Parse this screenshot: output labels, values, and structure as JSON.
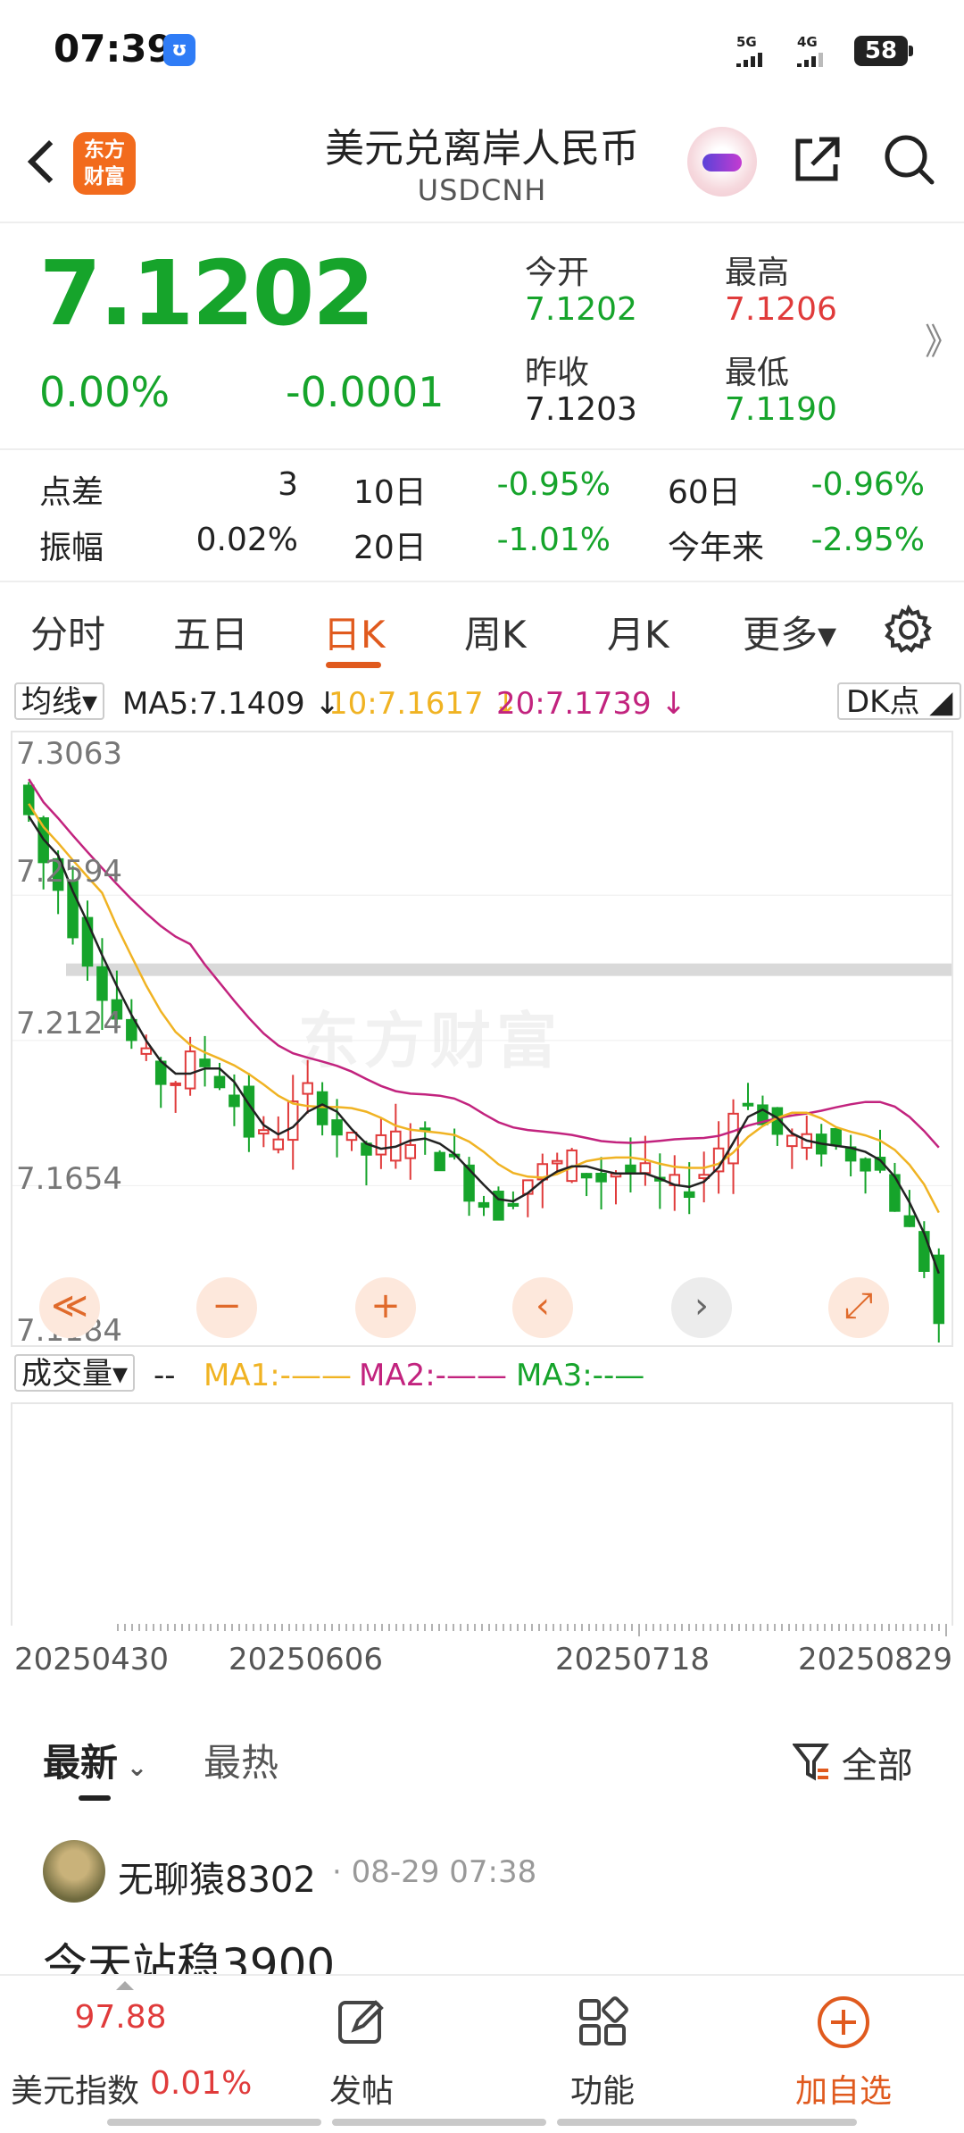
{
  "status_bar": {
    "time": "07:39",
    "app_badge": "ʊ",
    "signal_1": "5G",
    "signal_2": "4G",
    "battery": "58"
  },
  "header": {
    "logo_line1": "东方",
    "logo_line2": "财富",
    "title": "美元兑离岸人民币",
    "subtitle": "USDCNH"
  },
  "quote": {
    "price": "7.1202",
    "change_pct": "0.00%",
    "change": "-0.0001",
    "open_label": "今开",
    "open": "7.1202",
    "high_label": "最高",
    "high": "7.1206",
    "prev_close_label": "昨收",
    "prev_close": "7.1203",
    "low_label": "最低",
    "low": "7.1190",
    "more": "》"
  },
  "stats": {
    "spread_label": "点差",
    "spread": "3",
    "amplitude_label": "振幅",
    "amplitude": "0.02%",
    "d10_label": "10日",
    "d10": "-0.95%",
    "d20_label": "20日",
    "d20": "-1.01%",
    "d60_label": "60日",
    "d60": "-0.96%",
    "ytd_label": "今年来",
    "ytd": "-2.95%"
  },
  "tabs": [
    "分时",
    "五日",
    "日K",
    "周K",
    "月K",
    "更多▾"
  ],
  "active_tab": "日K",
  "ma_row": {
    "selector": "均线▾",
    "ma5": "MA5:7.1409 ↓",
    "ma10": "10:7.1617 ↓",
    "ma20": "20:7.1739 ↓",
    "dk": "DK点 ◢"
  },
  "chart_controls": [
    "≪",
    "−",
    "+",
    "‹",
    "›",
    "⤢"
  ],
  "watermark": "东方财富",
  "volume_row": {
    "selector": "成交量▾",
    "dash": "--",
    "ma1": "MA1:-——",
    "ma2": "MA2:-——",
    "ma3": "MA3:--—"
  },
  "feed": {
    "tab_latest": "最新",
    "tab_hot": "最热",
    "filter": "全部"
  },
  "post": {
    "user": "无聊猿8302",
    "time": "· 08-29 07:38",
    "text": "今天站稳3900"
  },
  "bottom_bar": {
    "index_value": "97.88",
    "index_name": "美元指数",
    "index_change": "0.01%",
    "post": "发帖",
    "func": "功能",
    "add": "加自选"
  },
  "colors": {
    "up": "#e03b3b",
    "down": "#16a42b",
    "accent": "#e05a1e",
    "ma5": "#222222",
    "ma10": "#f0b323",
    "ma20": "#c2237e"
  },
  "chart_data": {
    "type": "candlestick",
    "yticks": [
      "7.3063",
      "7.2594",
      "7.2124",
      "7.1654",
      "7.1184"
    ],
    "ylim": [
      7.1184,
      7.3063
    ],
    "xticks": [
      "20250430",
      "20250606",
      "20250718",
      "20250829"
    ],
    "series_names": [
      "MA5",
      "10",
      "20"
    ],
    "close_mid": [
      7.285,
      7.27,
      7.262,
      7.25,
      7.24,
      7.23,
      7.22,
      7.212,
      7.205,
      7.2,
      7.2,
      7.205,
      7.205,
      7.2,
      7.192,
      7.183,
      7.18,
      7.183,
      7.19,
      7.195,
      7.19,
      7.183,
      7.178,
      7.176,
      7.178,
      7.18,
      7.182,
      7.18,
      7.175,
      7.172,
      7.165,
      7.16,
      7.158,
      7.163,
      7.168,
      7.17,
      7.172,
      7.173,
      7.17,
      7.168,
      7.17,
      7.17,
      7.168,
      7.165,
      7.164,
      7.166,
      7.17,
      7.178,
      7.19,
      7.195,
      7.185,
      7.182,
      7.18,
      7.178,
      7.179,
      7.178,
      7.176,
      7.175,
      7.17,
      7.16,
      7.15,
      7.14,
      7.121
    ]
  }
}
